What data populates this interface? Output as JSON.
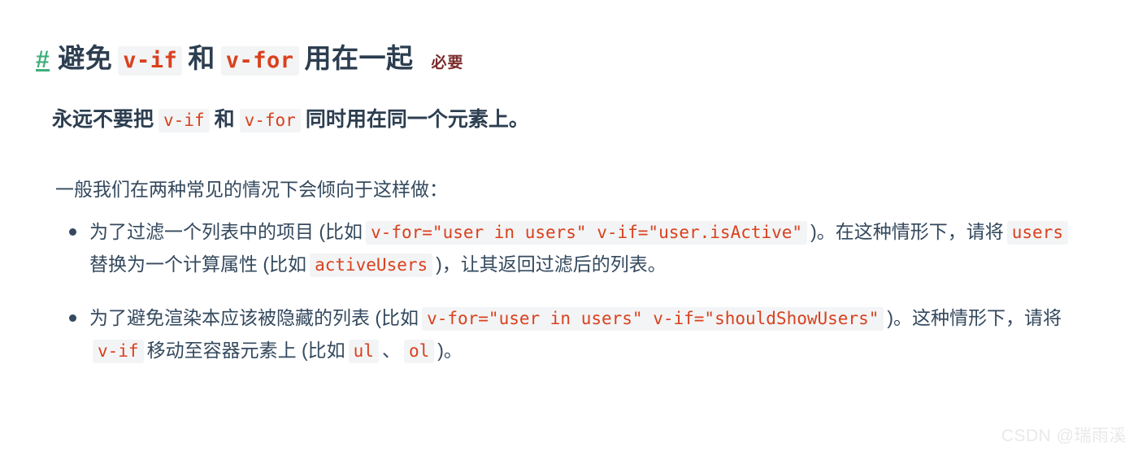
{
  "colors": {
    "background": "#ffffff",
    "body_text": "#34495e",
    "heading_text": "#2c3e50",
    "anchor_green": "#3eaf7c",
    "code_text": "#d9411e",
    "code_background": "#f3f4f5",
    "badge_text": "#7b2c2c",
    "watermark": "#e9e9ea"
  },
  "heading": {
    "anchor": "#",
    "part1": "避免",
    "code1": "v-if",
    "part2": "和",
    "code2": "v-for",
    "part3": "用在一起",
    "badge": "必要"
  },
  "lead": {
    "part1": "永远不要把",
    "code1": "v-if",
    "part2": "和",
    "code2": "v-for",
    "part3": "同时用在同一个元素上。"
  },
  "paragraph": "一般我们在两种常见的情况下会倾向于这样做：",
  "bullets": [
    {
      "part1": "为了过滤一个列表中的项目 (比如",
      "code1": "v-for=\"user in users\" v-if=\"user.isActive\"",
      "part2": ")。在这种情形下，请将",
      "code2": "users",
      "part3": "替换为一个计算属性 (比如",
      "code3": "activeUsers",
      "part4": ")，让其返回过滤后的列表。"
    },
    {
      "part1": "为了避免渲染本应该被隐藏的列表 (比如",
      "code1": "v-for=\"user in users\" v-if=\"shouldShowUsers\"",
      "part2": ")。这种情形下，请将",
      "code2": "v-if",
      "part3": "移动至容器元素上 (比如",
      "code3": "ul",
      "part4": "、",
      "code4": "ol",
      "part5": ")。"
    }
  ],
  "watermark": "CSDN @瑞雨溪"
}
